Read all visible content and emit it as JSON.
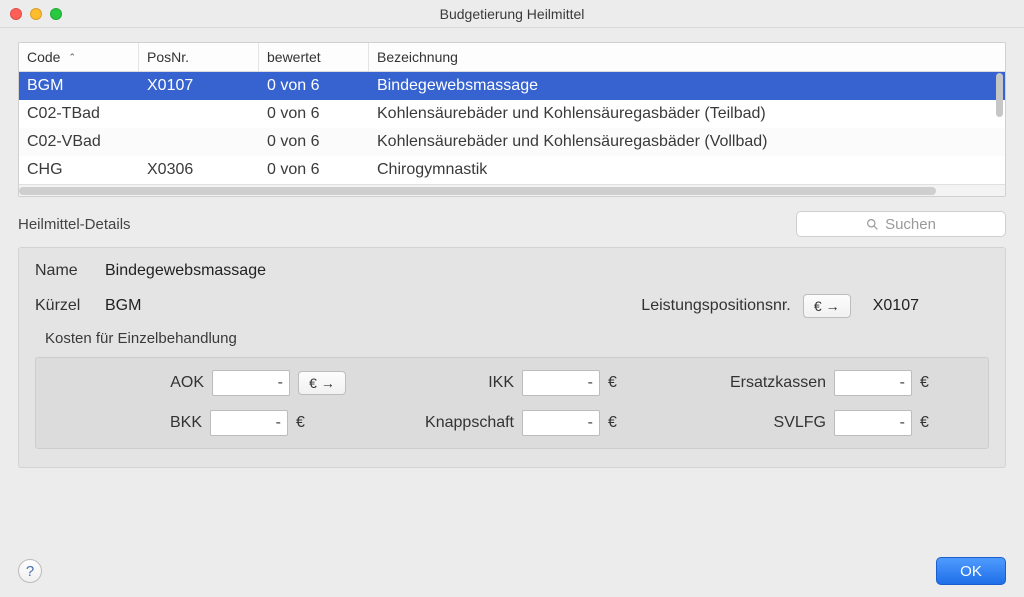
{
  "window": {
    "title": "Budgetierung Heilmittel"
  },
  "table": {
    "columns": {
      "c0": "Code",
      "c1": "PosNr.",
      "c2": "bewertet",
      "c3": "Bezeichnung"
    },
    "rows": [
      {
        "code": "BGM",
        "posnr": "X0107",
        "bewertet": "0 von 6",
        "bezeichnung": "Bindegewebsmassage"
      },
      {
        "code": "C02-TBad",
        "posnr": "",
        "bewertet": "0 von 6",
        "bezeichnung": "Kohlensäurebäder und Kohlensäuregasbäder (Teilbad)"
      },
      {
        "code": "C02-VBad",
        "posnr": "",
        "bewertet": "0 von 6",
        "bezeichnung": "Kohlensäurebäder und Kohlensäuregasbäder (Vollbad)"
      },
      {
        "code": "CHG",
        "posnr": "X0306",
        "bewertet": "0 von 6",
        "bezeichnung": "Chirogymnastik"
      }
    ]
  },
  "search": {
    "placeholder": "Suchen"
  },
  "details": {
    "section_label": "Heilmittel-Details",
    "name_label": "Name",
    "name_value": "Bindegewebsmassage",
    "kuerzel_label": "Kürzel",
    "kuerzel_value": "BGM",
    "lpn_label": "Leistungspositionsnr.",
    "lpn_value": "X0107",
    "euro_btn": "€ →",
    "kosten_label": "Kosten für Einzelbehandlung",
    "kassen": {
      "aok": {
        "label": "AOK",
        "value": "-",
        "unit_btn": "€ →"
      },
      "ikk": {
        "label": "IKK",
        "value": "-",
        "unit": "€"
      },
      "ersatz": {
        "label": "Ersatzkassen",
        "value": "-",
        "unit": "€"
      },
      "bkk": {
        "label": "BKK",
        "value": "-",
        "unit": "€"
      },
      "knapp": {
        "label": "Knappschaft",
        "value": "-",
        "unit": "€"
      },
      "svlfg": {
        "label": "SVLFG",
        "value": "-",
        "unit": "€"
      }
    }
  },
  "footer": {
    "help": "?",
    "ok": "OK"
  }
}
